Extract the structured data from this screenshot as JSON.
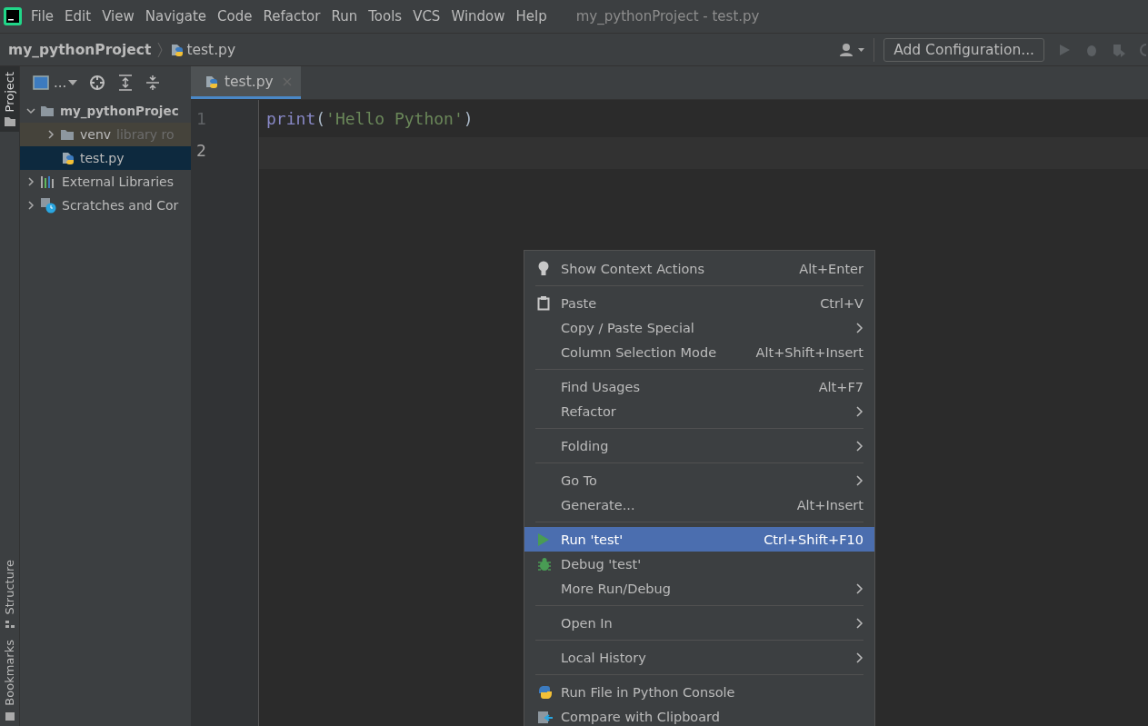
{
  "menubar": {
    "items": [
      "File",
      "Edit",
      "View",
      "Navigate",
      "Code",
      "Refactor",
      "Run",
      "Tools",
      "VCS",
      "Window",
      "Help"
    ],
    "title": "my_pythonProject - test.py"
  },
  "navbar": {
    "breadcrumbs": [
      "my_pythonProject",
      "test.py"
    ],
    "config_button": "Add Configuration..."
  },
  "tool_stripe": {
    "top": [
      {
        "label": "Project",
        "selected": true
      }
    ],
    "bottom": [
      {
        "label": "Structure",
        "selected": false
      },
      {
        "label": "Bookmarks",
        "selected": false
      }
    ]
  },
  "project_tree": {
    "toolbar_label": "...",
    "items": [
      {
        "label": "my_pythonProjec",
        "kind": "folder",
        "expanded": true,
        "selected": false,
        "children": [
          {
            "label": "venv",
            "note": "library ro",
            "kind": "folder",
            "expanded": false,
            "selected": false
          },
          {
            "label": "test.py",
            "kind": "python",
            "selected": true
          }
        ]
      },
      {
        "label": "External Libraries",
        "kind": "library",
        "expanded": false,
        "selected": false
      },
      {
        "label": "Scratches and Cor",
        "kind": "scratch",
        "expanded": false,
        "selected": false
      }
    ]
  },
  "editor": {
    "tabs": [
      {
        "label": "test.py",
        "selected": true
      }
    ],
    "lines": [
      {
        "number": "1",
        "code": "print('Hello Python')"
      },
      {
        "number": "2"
      }
    ]
  },
  "context_menu": {
    "groups": [
      [
        {
          "label": "Show Context Actions",
          "shortcut": "Alt+Enter",
          "kind": "bulb",
          "submenu": false,
          "selected": false
        }
      ],
      [
        {
          "label": "Paste",
          "shortcut": "Ctrl+V",
          "kind": "clipboard",
          "submenu": false,
          "selected": false
        },
        {
          "label": "Copy / Paste Special",
          "submenu": true,
          "selected": false
        },
        {
          "label": "Column Selection Mode",
          "shortcut": "Alt+Shift+Insert",
          "submenu": false,
          "selected": false
        }
      ],
      [
        {
          "label": "Find Usages",
          "shortcut": "Alt+F7",
          "submenu": false,
          "selected": false
        },
        {
          "label": "Refactor",
          "submenu": true,
          "selected": false
        }
      ],
      [
        {
          "label": "Folding",
          "submenu": true,
          "selected": false
        }
      ],
      [
        {
          "label": "Go To",
          "submenu": true,
          "selected": false
        },
        {
          "label": "Generate...",
          "shortcut": "Alt+Insert",
          "submenu": false,
          "selected": false
        }
      ],
      [
        {
          "label": "Run 'test'",
          "shortcut": "Ctrl+Shift+F10",
          "kind": "run",
          "submenu": false,
          "selected": true
        },
        {
          "label": "Debug 'test'",
          "kind": "bug",
          "submenu": false,
          "selected": false
        },
        {
          "label": "More Run/Debug",
          "submenu": true,
          "selected": false
        }
      ],
      [
        {
          "label": "Open In",
          "submenu": true,
          "selected": false
        }
      ],
      [
        {
          "label": "Local History",
          "submenu": true,
          "selected": false
        }
      ],
      [
        {
          "label": "Run File in Python Console",
          "kind": "python",
          "submenu": false,
          "selected": false
        },
        {
          "label": "Compare with Clipboard",
          "kind": "compare",
          "submenu": false,
          "selected": false
        }
      ]
    ]
  }
}
